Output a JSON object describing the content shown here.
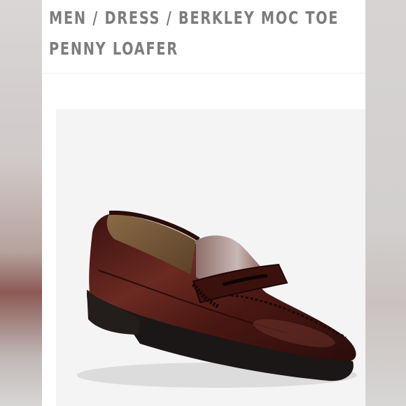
{
  "listing": {
    "breadcrumb_title": "MEN / DRESS / BERKLEY MOC TOE PENNY LOAFER"
  },
  "product_image": {
    "subject": "shoe-image"
  },
  "colors": {
    "title_text": "#7d7d7d",
    "image_background": "#f4f4f5",
    "leather": "#5a1f1a",
    "sole": "#1b1716"
  }
}
